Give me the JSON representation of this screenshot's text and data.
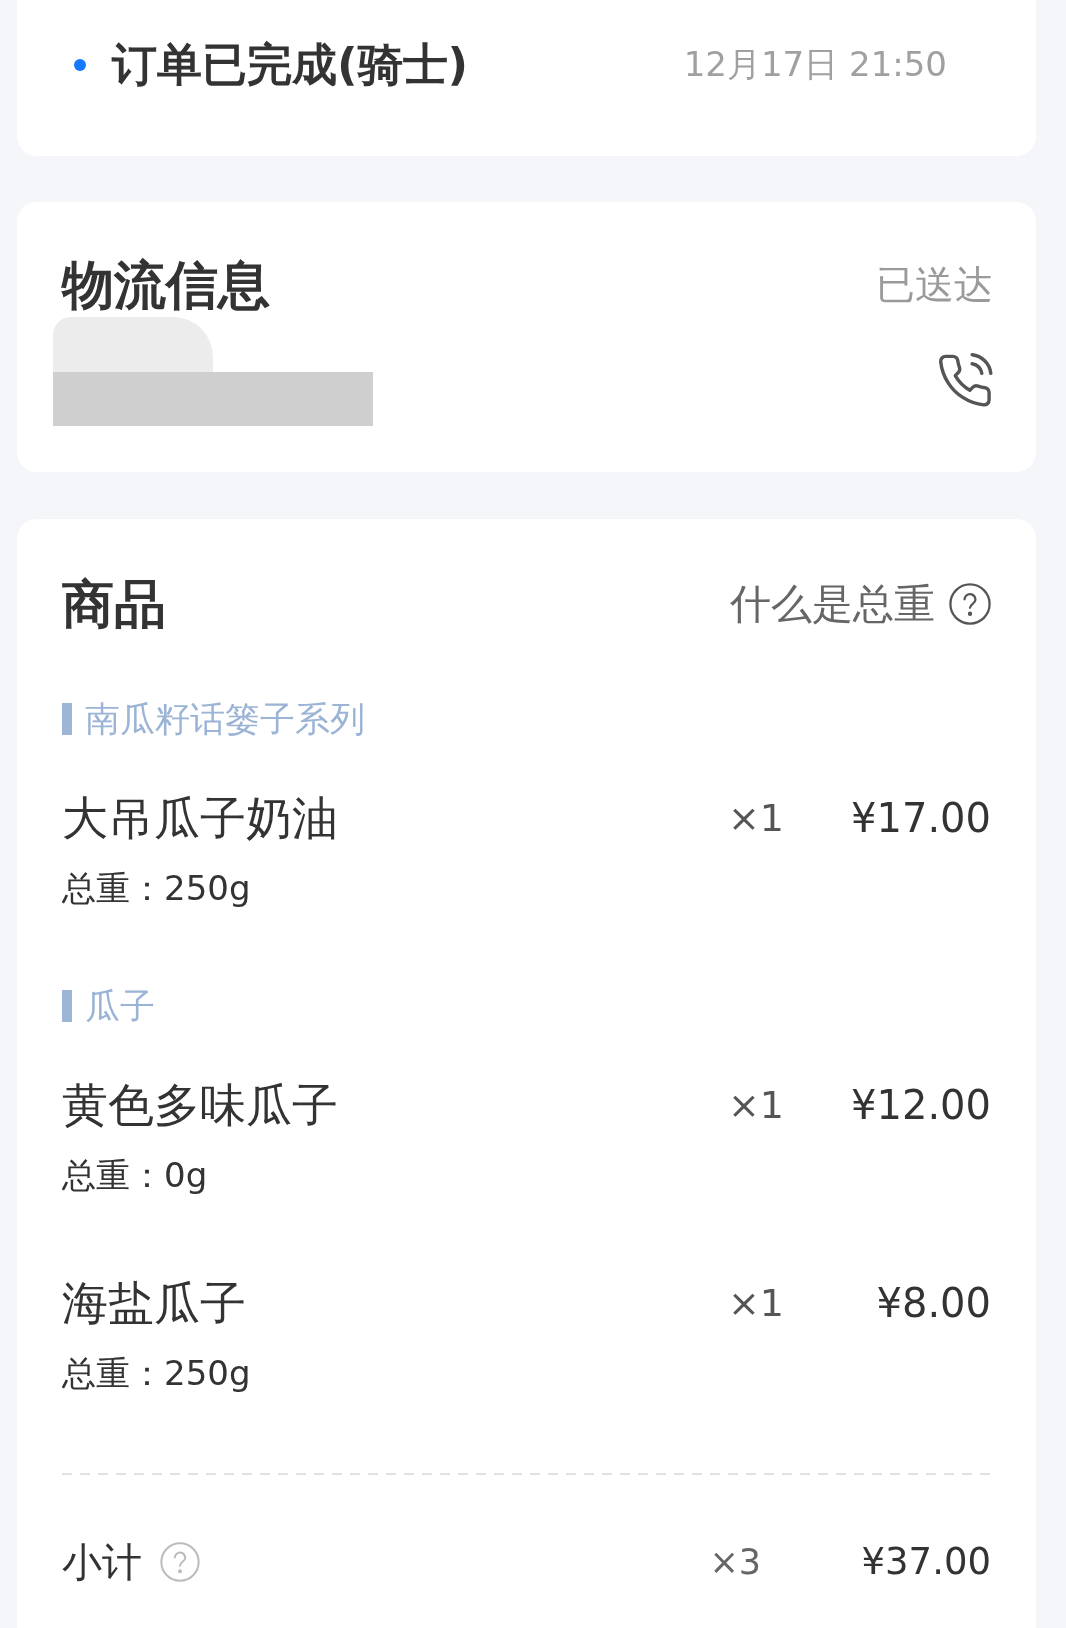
{
  "order_status": {
    "title": "订单已完成(骑士)",
    "time": "12月17日 21:50"
  },
  "logistics": {
    "title": "物流信息",
    "status": "已送达"
  },
  "products": {
    "title": "商品",
    "help_link": "什么是总重",
    "groups": [
      {
        "category": "南瓜籽话篓子系列",
        "items": [
          {
            "name": "大吊瓜子奶油",
            "quantity": "×1",
            "price": "¥17.00",
            "weight": "总重：250g"
          }
        ]
      },
      {
        "category": "瓜子",
        "items": [
          {
            "name": "黄色多味瓜子",
            "quantity": "×1",
            "price": "¥12.00",
            "weight": "总重：0g"
          },
          {
            "name": "海盐瓜子",
            "quantity": "×1",
            "price": "¥8.00",
            "weight": "总重：250g"
          }
        ]
      }
    ],
    "subtotal": {
      "label": "小计",
      "quantity": "×3",
      "price": "¥37.00"
    }
  }
}
